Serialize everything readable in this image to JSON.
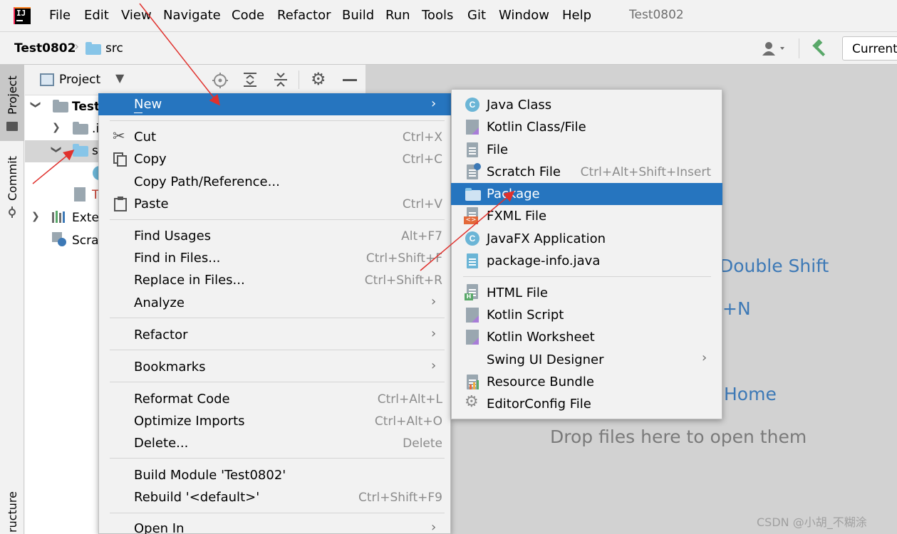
{
  "menubar": {
    "items": [
      "File",
      "Edit",
      "View",
      "Navigate",
      "Code",
      "Refactor",
      "Build",
      "Run",
      "Tools",
      "Git",
      "Window",
      "Help"
    ],
    "project_title": "Test0802"
  },
  "navbar": {
    "project": "Test0802",
    "folder": "src",
    "run_config": "Current"
  },
  "tool_strip": {
    "project_tab": "Project",
    "commit_tab": "Commit",
    "structure_tab": "ructure"
  },
  "project_panel": {
    "view_label": "Project",
    "tree": {
      "root": "Test",
      "idea": ".i",
      "src": "s",
      "file": "T",
      "external": "Exter",
      "scratches": "Scrat"
    }
  },
  "context_menu": {
    "items": [
      {
        "label": "New",
        "mnemonic": "N",
        "submenu": true
      },
      {
        "label": "Cut",
        "mnemonic": "t",
        "shortcut": "Ctrl+X",
        "icon": "scissors-icon"
      },
      {
        "label": "Copy",
        "mnemonic": "C",
        "shortcut": "Ctrl+C",
        "icon": "copy-icon"
      },
      {
        "label": "Copy Path/Reference..."
      },
      {
        "label": "Paste",
        "mnemonic": "P",
        "shortcut": "Ctrl+V",
        "icon": "clipboard-icon"
      },
      {
        "label": "Find Usages",
        "mnemonic": "U",
        "shortcut": "Alt+F7"
      },
      {
        "label": "Find in Files...",
        "shortcut": "Ctrl+Shift+F"
      },
      {
        "label": "Replace in Files...",
        "mnemonic": "a",
        "shortcut": "Ctrl+Shift+R"
      },
      {
        "label": "Analyze",
        "submenu": true
      },
      {
        "label": "Refactor",
        "mnemonic": "R",
        "submenu": true
      },
      {
        "label": "Bookmarks",
        "submenu": true
      },
      {
        "label": "Reformat Code",
        "mnemonic": "R",
        "shortcut": "Ctrl+Alt+L"
      },
      {
        "label": "Optimize Imports",
        "mnemonic": "z",
        "shortcut": "Ctrl+Alt+O"
      },
      {
        "label": "Delete...",
        "mnemonic": "D",
        "shortcut": "Delete"
      },
      {
        "label": "Build Module 'Test0802'",
        "mnemonic": "M"
      },
      {
        "label": "Rebuild '<default>'",
        "mnemonic": "e",
        "shortcut": "Ctrl+Shift+F9"
      },
      {
        "label": "Open In",
        "submenu": true
      }
    ]
  },
  "new_submenu": {
    "items": [
      {
        "label": "Java Class",
        "icon": "java-class-icon"
      },
      {
        "label": "Kotlin Class/File",
        "icon": "kotlin-file-icon"
      },
      {
        "label": "File",
        "icon": "file-icon"
      },
      {
        "label": "Scratch File",
        "shortcut": "Ctrl+Alt+Shift+Insert",
        "icon": "scratch-file-icon"
      },
      {
        "label": "Package",
        "icon": "package-icon",
        "selected": true
      },
      {
        "label": "FXML File",
        "icon": "fxml-file-icon"
      },
      {
        "label": "JavaFX Application",
        "icon": "javafx-app-icon"
      },
      {
        "label": "package-info.java",
        "icon": "java-file-icon"
      },
      {
        "label": "HTML File",
        "icon": "html-file-icon"
      },
      {
        "label": "Kotlin Script",
        "icon": "kotlin-script-icon"
      },
      {
        "label": "Kotlin Worksheet",
        "icon": "kotlin-worksheet-icon"
      },
      {
        "label": "Swing UI Designer",
        "submenu": true
      },
      {
        "label": "Resource Bundle",
        "icon": "resource-bundle-icon"
      },
      {
        "label": "EditorConfig File",
        "icon": "gear-icon"
      }
    ]
  },
  "editor_hints": {
    "search_everywhere": "Double Shift",
    "new_shortcut": "+N",
    "home": "Home",
    "drop_files": "Drop files here to open them"
  },
  "watermark": "CSDN @小胡_不糊涂",
  "colors": {
    "selection": "#2675bf",
    "annotation_arrow": "#e0312d",
    "hint_text": "#3d79b6"
  }
}
